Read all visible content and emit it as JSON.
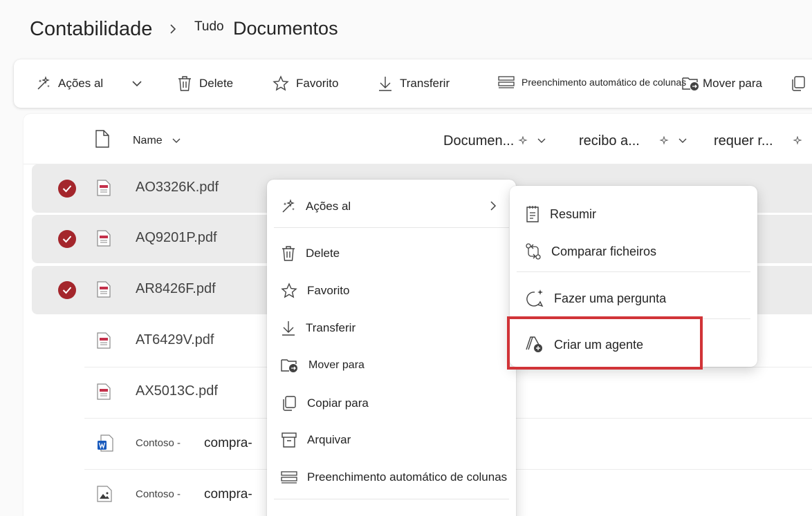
{
  "breadcrumb": {
    "root": "Contabilidade",
    "small": "Tudo",
    "current": "Documentos"
  },
  "toolbar": {
    "ai_actions": "Ações al",
    "delete": "Delete",
    "favorite": "Favorito",
    "download": "Transferir",
    "autofill": "Preenchimento automático de colunas",
    "move": "Mover para"
  },
  "columns": {
    "name": "Name",
    "document": "Documen...",
    "receipt": "recibo a...",
    "requires": "requer r..."
  },
  "files": [
    {
      "name": "AO3326K.pdf",
      "type": "pdf",
      "selected": true
    },
    {
      "name": "AQ9201P.pdf",
      "type": "pdf",
      "selected": true
    },
    {
      "name": "AR8426F.pdf",
      "type": "pdf",
      "selected": true
    },
    {
      "name": "AT6429V.pdf",
      "type": "pdf",
      "selected": false
    },
    {
      "name": "AX5013C.pdf",
      "type": "pdf",
      "selected": false
    },
    {
      "name": "Contoso -",
      "name_2": "compra-",
      "type": "word",
      "selected": false
    },
    {
      "name": "Contoso -",
      "name_2": "compra-",
      "type": "image",
      "selected": false
    }
  ],
  "context_menu": {
    "ai_actions": "Ações al",
    "delete": "Delete",
    "favorite": "Favorito",
    "download": "Transferir",
    "move": "Mover para",
    "copy": "Copiar para",
    "archive": "Arquivar",
    "autofill": "Preenchimento automático de colunas"
  },
  "submenu": {
    "summarize": "Resumir",
    "compare": "Comparar ficheiros",
    "ask": "Fazer uma pergunta",
    "create_agent": "Criar um agente"
  },
  "colors": {
    "selected_check": "#a4262c",
    "highlight_border": "#d13438",
    "selected_row": "#ebebeb"
  }
}
